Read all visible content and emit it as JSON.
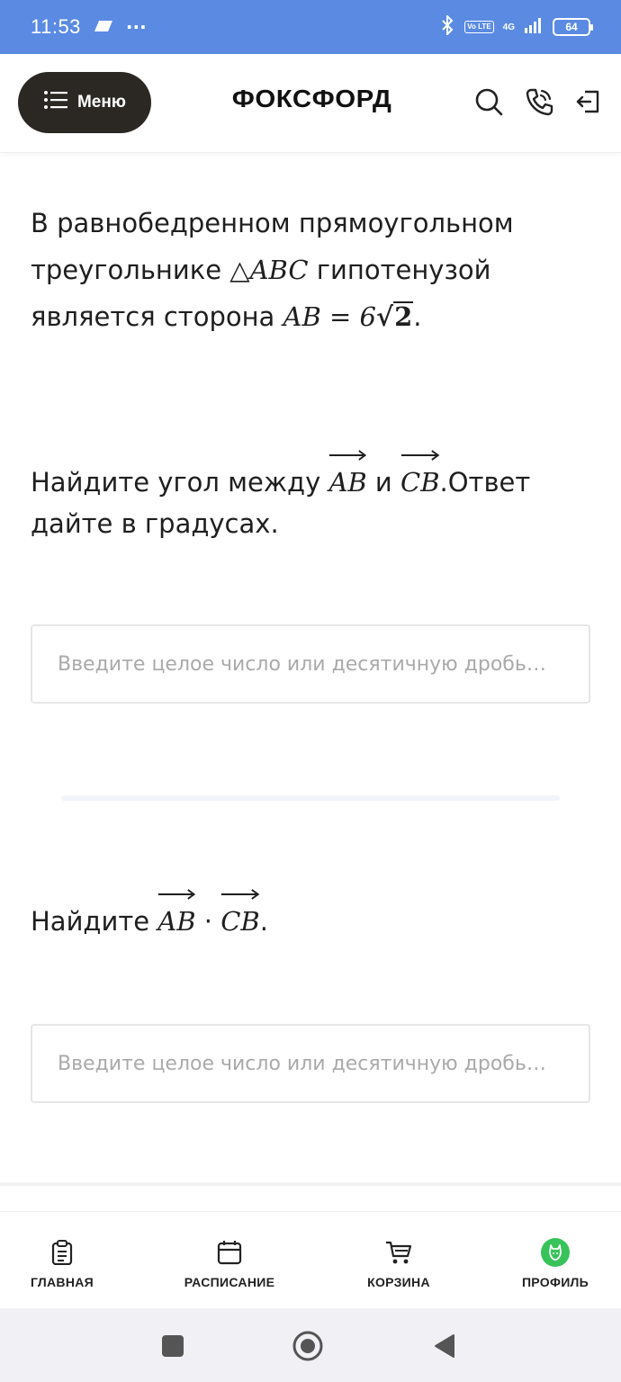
{
  "status_bar": {
    "time": "11:53",
    "dots": "···",
    "network": "4G",
    "volte": "Vo LTE",
    "battery": "64"
  },
  "header": {
    "menu_label": "Меню",
    "logo": "ФОКСФОРД"
  },
  "problem": {
    "intro_line1": "В равнобедренном прямоугольном",
    "intro_line2_a": "треугольнике ",
    "triangle": "△ABC",
    "intro_line2_b": " гипотенузой",
    "intro_line3_a": "является сторона ",
    "ab_eq": "AB = 6",
    "sqrt_arg": "2",
    "intro_end": "."
  },
  "question1": {
    "text_a": "Найдите угол между ",
    "vec1": "AB",
    "conj": " и ",
    "vec2": "CB",
    "text_b": ".Ответ",
    "line2": "дайте в градусах."
  },
  "answer1": {
    "placeholder": "Введите целое число или десятичную дробь…"
  },
  "question2": {
    "text_a": "Найдите ",
    "vec1": "AB",
    "dot": " · ",
    "vec2": "CB",
    "text_b": "."
  },
  "answer2": {
    "placeholder": "Введите целое число или десятичную дробь…"
  },
  "bottom_nav": {
    "items": [
      {
        "label": "ГЛАВНАЯ",
        "icon": "clipboard-icon"
      },
      {
        "label": "РАСПИСАНИЕ",
        "icon": "calendar-icon"
      },
      {
        "label": "КОРЗИНА",
        "icon": "cart-icon"
      },
      {
        "label": "ПРОФИЛЬ",
        "icon": "fox-avatar-icon"
      }
    ],
    "active_color": "#38c35a"
  },
  "colors": {
    "status_bar": "#5a8ae2",
    "menu_button": "#2b2723"
  }
}
